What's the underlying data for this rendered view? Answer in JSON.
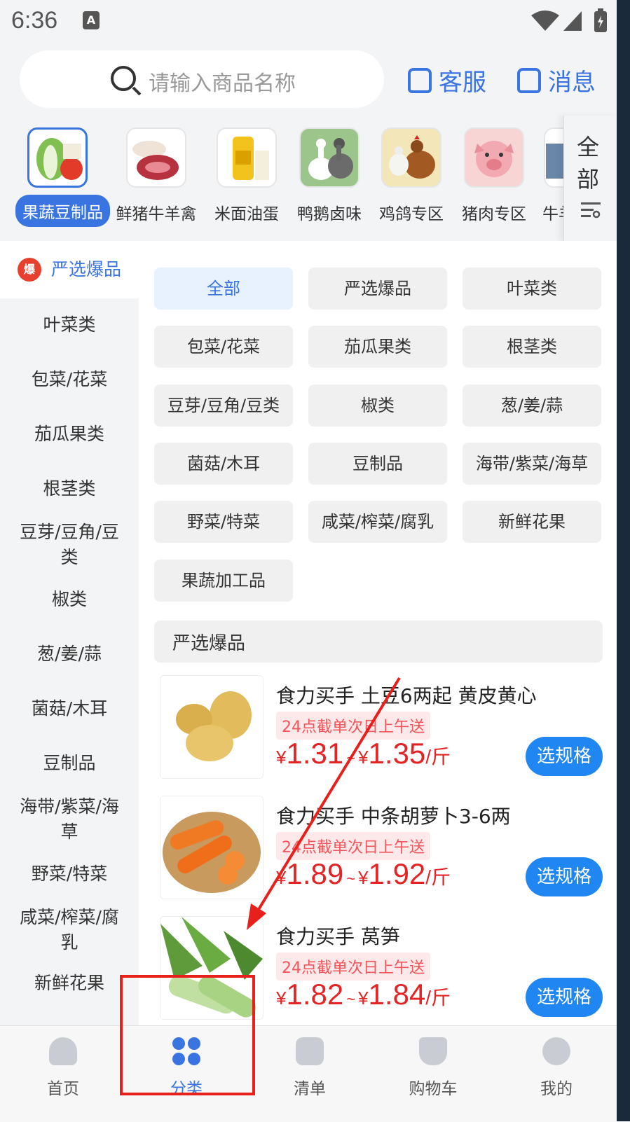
{
  "status": {
    "time": "6:36",
    "a_icon": "A"
  },
  "search": {
    "placeholder": "请输入商品名称"
  },
  "header": {
    "service_label": "客服",
    "message_label": "消息"
  },
  "categories": [
    {
      "label": "果蔬豆制品",
      "icon": "cabbage-icon"
    },
    {
      "label": "鲜猪牛羊禽",
      "icon": "meat-icon"
    },
    {
      "label": "米面油蛋",
      "icon": "oil-icon"
    },
    {
      "label": "鸭鹅卤味",
      "icon": "goose-icon"
    },
    {
      "label": "鸡鸽专区",
      "icon": "chicken-icon"
    },
    {
      "label": "猪肉专区",
      "icon": "pig-icon"
    },
    {
      "label": "牛羊",
      "icon": "cow-icon"
    }
  ],
  "all_panel": {
    "label": "全部"
  },
  "left_nav": {
    "active": {
      "label": "严选爆品",
      "badge": "爆"
    },
    "items": [
      "叶菜类",
      "包菜/花菜",
      "茄瓜果类",
      "根茎类",
      "豆芽/豆角/豆类",
      "椒类",
      "葱/姜/蒜",
      "菌菇/木耳",
      "豆制品",
      "海带/紫菜/海草",
      "野菜/特菜",
      "咸菜/榨菜/腐乳",
      "新鲜花果"
    ]
  },
  "chips": [
    "全部",
    "严选爆品",
    "叶菜类",
    "包菜/花菜",
    "茄瓜果类",
    "根茎类",
    "豆芽/豆角/豆类",
    "椒类",
    "葱/姜/蒜",
    "菌菇/木耳",
    "豆制品",
    "海带/紫菜/海草",
    "野菜/特菜",
    "咸菜/榨菜/腐乳",
    "新鲜花果",
    "果蔬加工品"
  ],
  "section_title": "严选爆品",
  "products": [
    {
      "name": "食力买手 土豆6两起 黄皮黄心",
      "tag": "24点截单次日上午送",
      "currency": "¥",
      "price_low": "1.31",
      "price_high": "1.35",
      "unit": "/斤",
      "button": "选规格"
    },
    {
      "name": "食力买手 中条胡萝卜3-6两",
      "tag": "24点截单次日上午送",
      "currency": "¥",
      "price_low": "1.89",
      "price_high": "1.92",
      "unit": "/斤",
      "button": "选规格"
    },
    {
      "name": "食力买手 莴笋",
      "tag": "24点截单次日上午送",
      "currency": "¥",
      "price_low": "1.82",
      "price_high": "1.84",
      "unit": "/斤",
      "button": "选规格"
    }
  ],
  "price_sep": "~",
  "tabs": [
    {
      "label": "首页",
      "icon": "home-icon"
    },
    {
      "label": "分类",
      "icon": "category-icon"
    },
    {
      "label": "清单",
      "icon": "list-icon"
    },
    {
      "label": "购物车",
      "icon": "cart-icon"
    },
    {
      "label": "我的",
      "icon": "profile-icon"
    }
  ],
  "colors": {
    "accent": "#3a74e0",
    "price": "#e42424",
    "highlight": "#e8201c"
  }
}
